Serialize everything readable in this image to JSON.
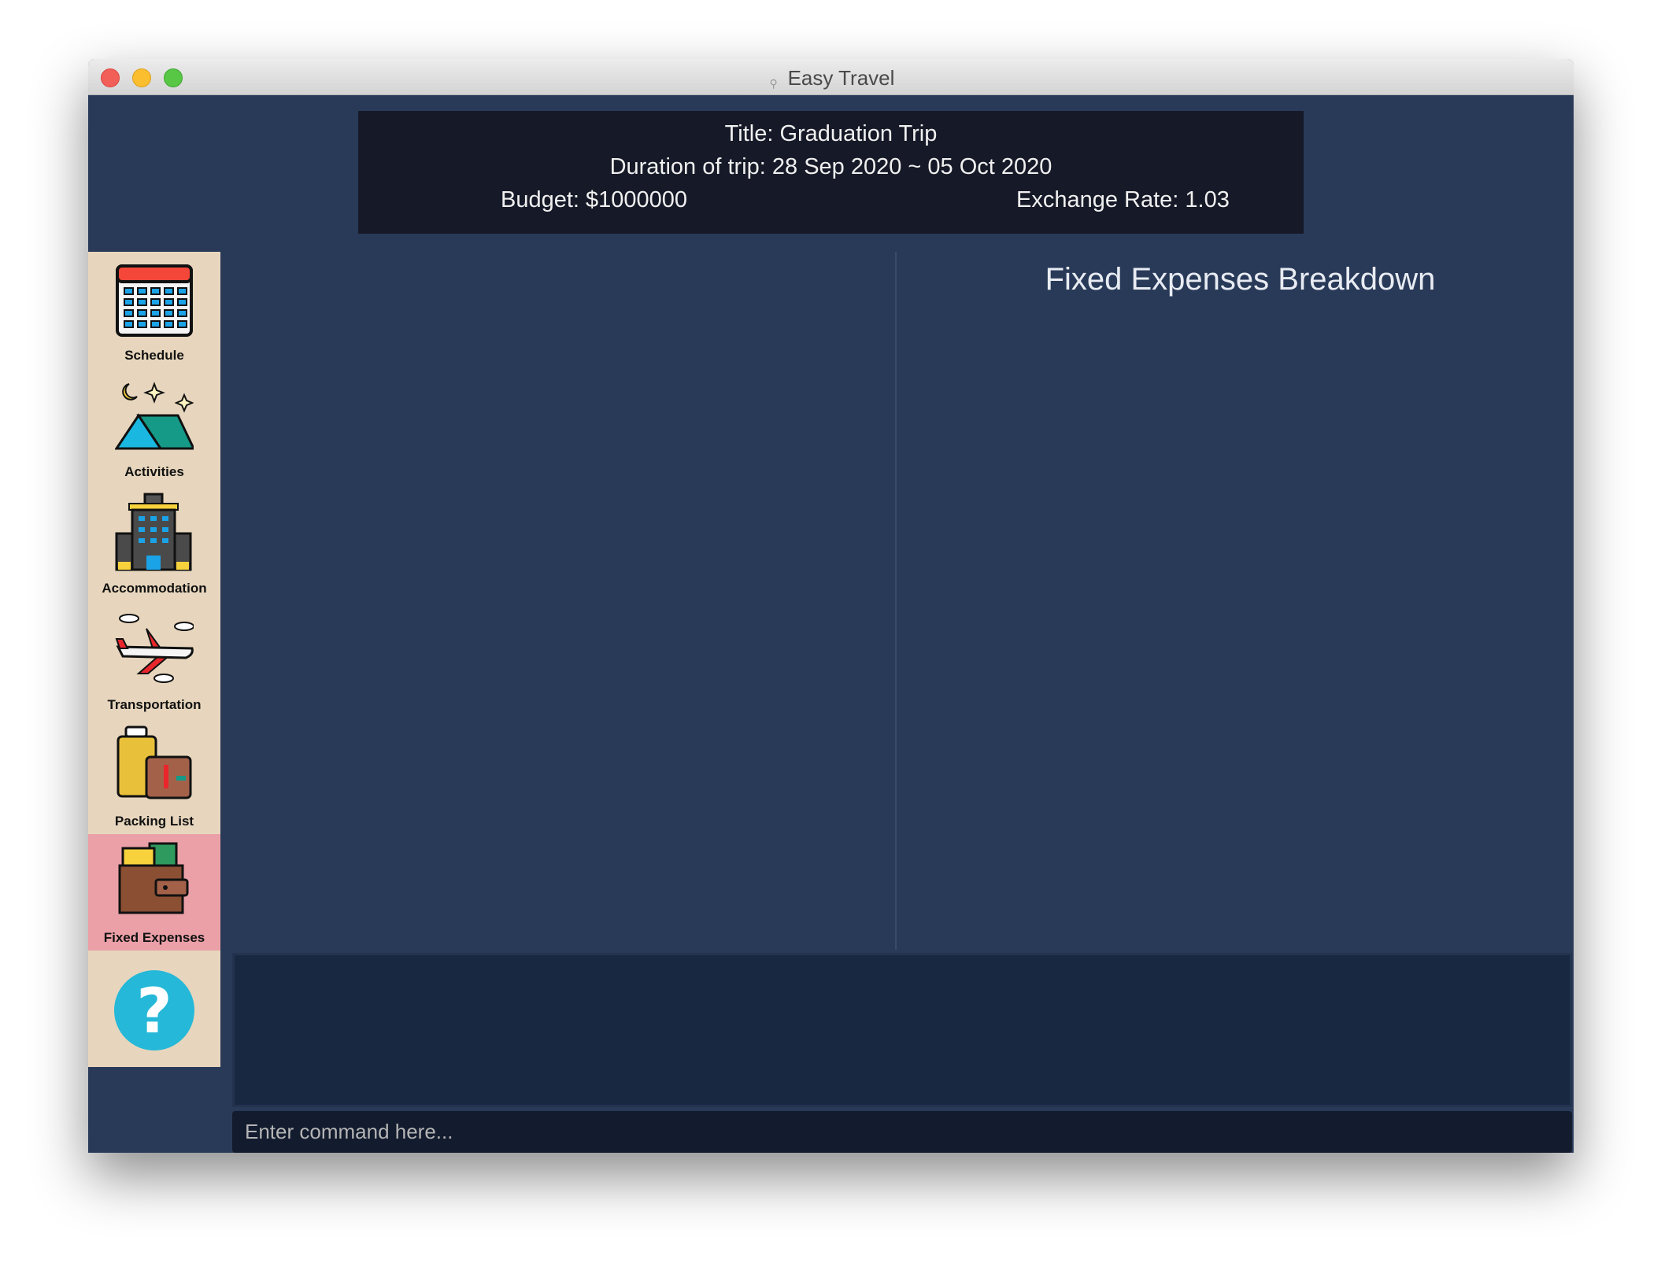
{
  "window": {
    "title": "Easy Travel"
  },
  "header": {
    "title": "Title: Graduation Trip",
    "duration": "Duration of trip: 28 Sep 2020 ~ 05 Oct 2020",
    "budget": "Budget: $1000000",
    "exchange_rate": "Exchange Rate: 1.03"
  },
  "sidebar": {
    "items": [
      {
        "label": "Schedule",
        "icon": "calendar-icon"
      },
      {
        "label": "Activities",
        "icon": "tent-icon"
      },
      {
        "label": "Accommodation",
        "icon": "hotel-icon"
      },
      {
        "label": "Transportation",
        "icon": "airplane-icon"
      },
      {
        "label": "Packing List",
        "icon": "luggage-icon"
      },
      {
        "label": "Fixed Expenses",
        "icon": "wallet-icon",
        "active": true
      },
      {
        "label": "",
        "icon": "help-icon"
      }
    ],
    "active_color": "#eba0a8",
    "background_color": "#e7d6bd"
  },
  "main": {
    "panel_title": "Fixed Expenses Breakdown"
  },
  "command": {
    "placeholder": "Enter command here...",
    "value": ""
  }
}
